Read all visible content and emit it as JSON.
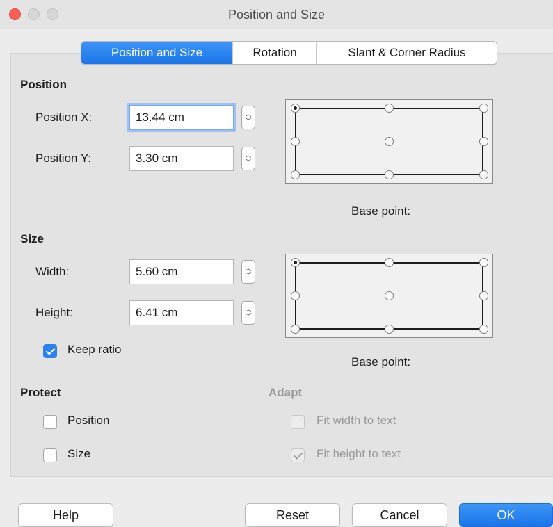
{
  "window": {
    "title": "Position and Size"
  },
  "tabs": [
    {
      "label": "Position and Size",
      "active": true
    },
    {
      "label": "Rotation",
      "active": false
    },
    {
      "label": "Slant & Corner Radius",
      "active": false
    }
  ],
  "position": {
    "heading": "Position",
    "x_label": "Position X:",
    "x_value": "13.44 cm",
    "y_label": "Position Y:",
    "y_value": "3.30 cm",
    "base_point_label": "Base point:"
  },
  "size": {
    "heading": "Size",
    "width_label": "Width:",
    "width_value": "5.60 cm",
    "height_label": "Height:",
    "height_value": "6.41 cm",
    "keep_ratio_label": "Keep ratio",
    "keep_ratio_checked": true,
    "base_point_label": "Base point:"
  },
  "protect": {
    "heading": "Protect",
    "position_label": "Position",
    "size_label": "Size"
  },
  "adapt": {
    "heading": "Adapt",
    "fit_width_label": "Fit width to text",
    "fit_height_label": "Fit height to text"
  },
  "buttons": {
    "help": "Help",
    "reset": "Reset",
    "cancel": "Cancel",
    "ok": "OK"
  },
  "colors": {
    "accent": "#1a74e8",
    "close": "#fd5f57"
  }
}
